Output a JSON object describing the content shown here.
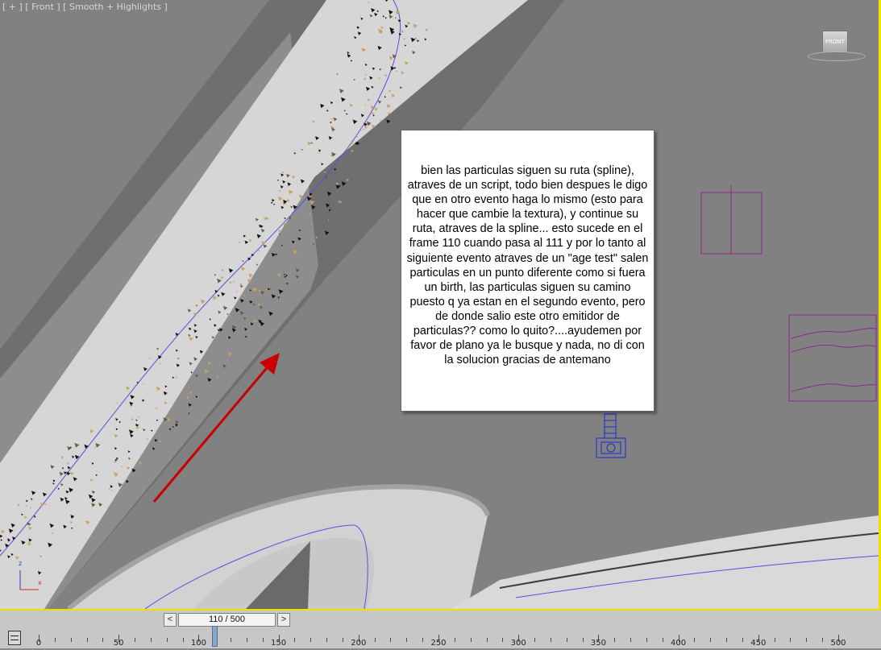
{
  "viewport": {
    "label": "[ + ] [ Front ] [ Smooth + Highlights ]",
    "view_cube": "FRONT",
    "axis_z": "z",
    "axis_x": "x"
  },
  "note": {
    "text": "bien las particulas siguen su ruta (spline), atraves de un script, todo bien despues le digo que en otro evento haga lo mismo (esto para hacer que cambie la textura), y continue su ruta, atraves de la spline... esto sucede en el frame 110 cuando pasa al 111 y por lo tanto al siguiente evento atraves de un \"age test\" salen particulas en un punto diferente como si fuera un birth, las particulas siguen su camino puesto q ya estan en el segundo evento, pero de donde salio este otro emitidor de particulas?? como lo quito?....ayudemen por favor de plano ya le busque y nada, no di con la solucion gracias de antemano"
  },
  "timeline": {
    "prev_label": "<",
    "next_label": ">",
    "frame_display": "110 / 500",
    "current_frame": 110,
    "total_frames": 500,
    "tick_labels": [
      "0",
      "50",
      "100",
      "150",
      "200",
      "250",
      "300",
      "350",
      "400",
      "450",
      "500"
    ]
  },
  "colors": {
    "viewport_bg": "#818181",
    "viewport_border": "#f0e000",
    "road": "#d9d9d9",
    "spline": "#5a4ee0",
    "arrow": "#c80000",
    "gizmo": "#8a2a8a",
    "emitter": "#1a2ad8"
  }
}
